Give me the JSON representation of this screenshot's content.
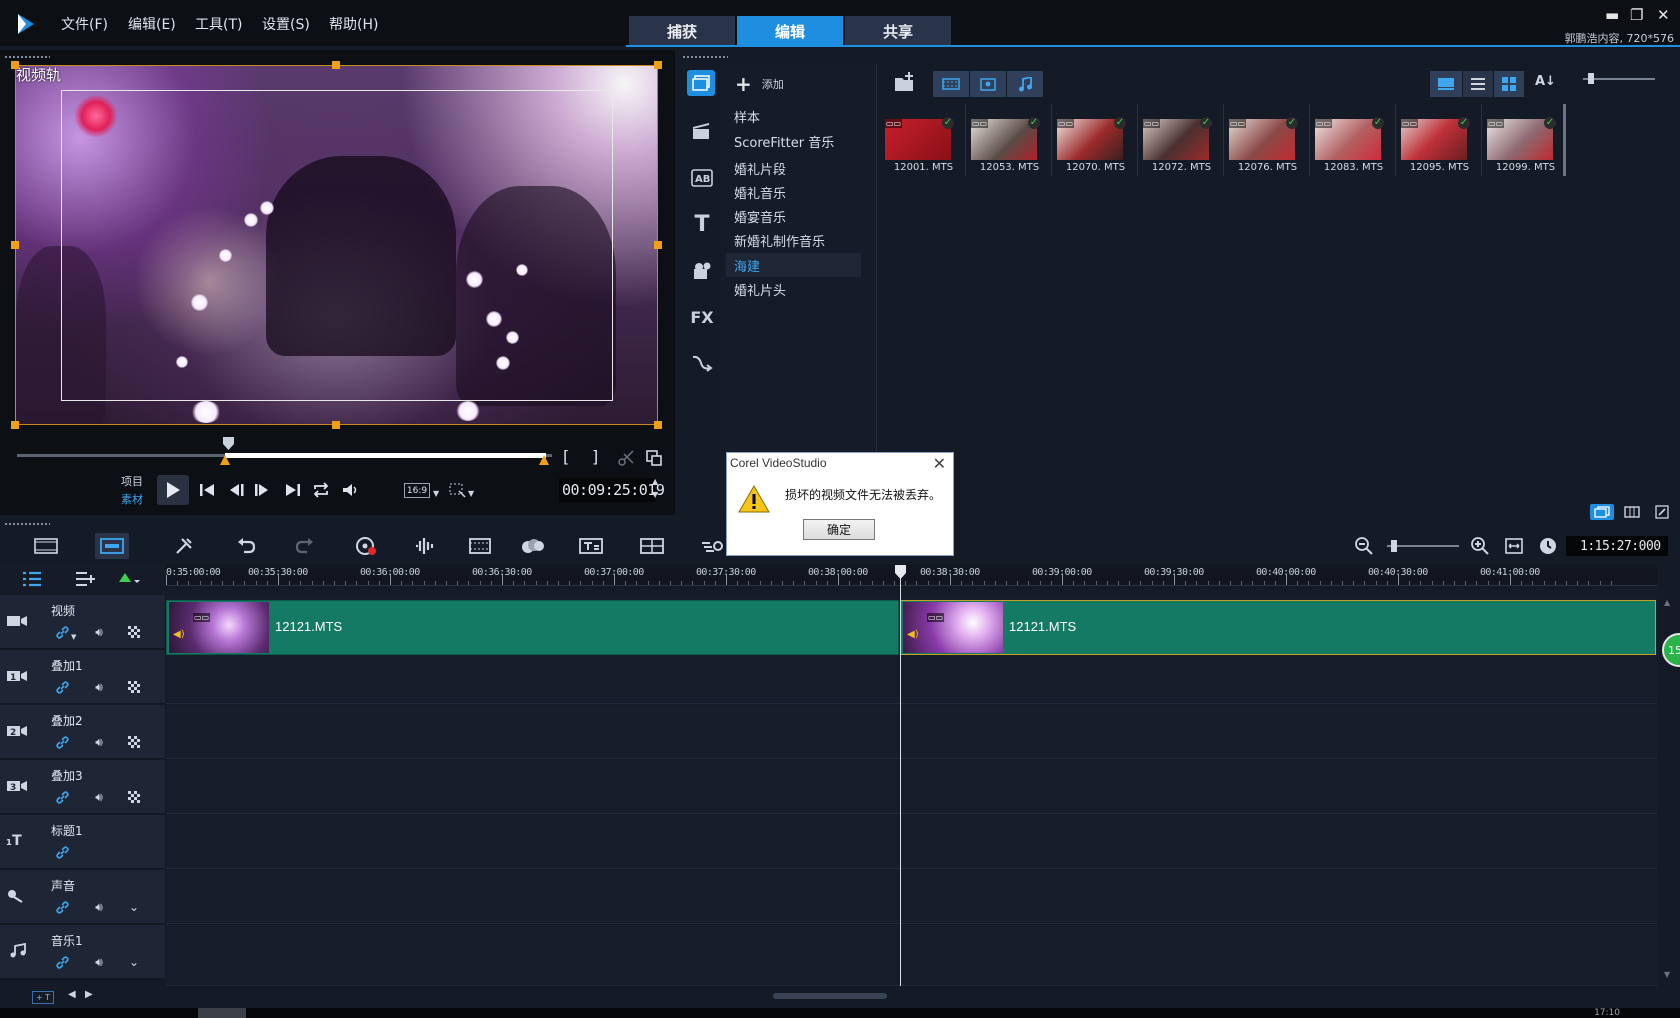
{
  "menu": {
    "items": [
      "文件(F)",
      "编辑(E)",
      "工具(T)",
      "设置(S)",
      "帮助(H)"
    ]
  },
  "mode_tabs": [
    {
      "label": "捕获",
      "active": false
    },
    {
      "label": "编辑",
      "active": true
    },
    {
      "label": "共享",
      "active": false
    }
  ],
  "window": {
    "project_info": "郭鹏浩内容, 720*576"
  },
  "preview": {
    "track_label": "视频轨",
    "project_label": "项目",
    "clip_label": "素材",
    "aspect": "16:9",
    "timecode": "00:09:25:019"
  },
  "library": {
    "add_label": "添加",
    "folders": [
      "样本",
      "ScoreFitter 音乐",
      "婚礼片段",
      "婚礼音乐",
      "婚宴音乐",
      "新婚礼制作音乐",
      "海建",
      "婚礼片头"
    ],
    "selected_folder": "海建",
    "strip_icons": [
      "media-icon",
      "instant-project-icon",
      "transition-icon",
      "title-icon",
      "graphics-icon",
      "filter-icon",
      "path-icon"
    ],
    "thumbnails": [
      {
        "name": "12001. MTS",
        "color": "#b0202a"
      },
      {
        "name": "12053. MTS",
        "color": "#7a6a66"
      },
      {
        "name": "12070. MTS",
        "color": "#8a2b2b"
      },
      {
        "name": "12072. MTS",
        "color": "#5a3a3a"
      },
      {
        "name": "12076. MTS",
        "color": "#7d4a48"
      },
      {
        "name": "12083. MTS",
        "color": "#9a5a55"
      },
      {
        "name": "12095. MTS",
        "color": "#a8302e"
      },
      {
        "name": "12099. MTS",
        "color": "#8c6a70"
      }
    ]
  },
  "dialog": {
    "title": "Corel VideoStudio",
    "message": "损坏的视频文件无法被丢弃。",
    "ok_label": "确定"
  },
  "timeline": {
    "total_duration": "1:15:27:000",
    "ruler_labels": [
      "0:35:00:00",
      "00:35:30:00",
      "00:36:00:00",
      "00:36:30:00",
      "00:37:00:00",
      "00:37:30:00",
      "00:38:00:00",
      "00:38:30:00",
      "00:39:00:00",
      "00:39:30:00",
      "00:40:00:00",
      "00:40:30:00",
      "00:41:00:00"
    ],
    "tracks": [
      {
        "name": "视频",
        "icon": "video-track-icon"
      },
      {
        "name": "叠加1",
        "icon": "overlay-1-icon"
      },
      {
        "name": "叠加2",
        "icon": "overlay-2-icon"
      },
      {
        "name": "叠加3",
        "icon": "overlay-3-icon"
      },
      {
        "name": "标题1",
        "icon": "title-track-icon"
      },
      {
        "name": "声音",
        "icon": "voice-track-icon"
      },
      {
        "name": "音乐1",
        "icon": "music-track-icon"
      }
    ],
    "clips": [
      {
        "title": "12121.MTS"
      },
      {
        "title": "12121.MTS"
      }
    ],
    "badge": "15"
  },
  "status": {
    "clock": "17:10"
  }
}
